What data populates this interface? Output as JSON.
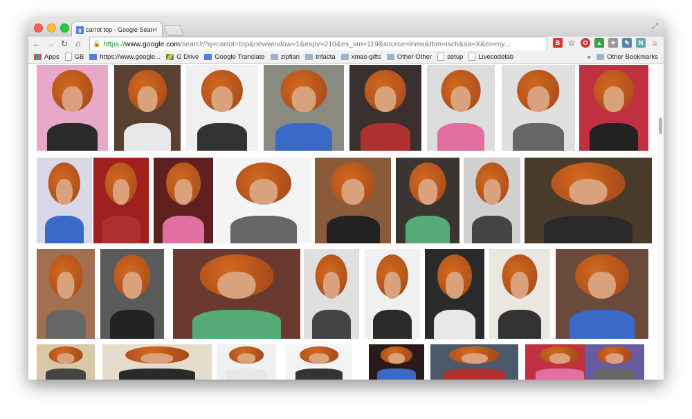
{
  "browser": {
    "tab_title": "carrot top - Google Search",
    "tab_close": "×",
    "url_scheme": "https://",
    "url_host": "www.google.com",
    "url_rest": "/search?q=carrot+top&newwindow=1&espv=210&es_sm=119&source=lnms&tbm=isch&sa=X&ei=my..."
  },
  "bookmarks": [
    {
      "label": "Apps",
      "icon": "apps-grid-icon"
    },
    {
      "label": "GB",
      "icon": "page-icon"
    },
    {
      "label": "https://www.google...",
      "icon": "google-icon"
    },
    {
      "label": "G Drive",
      "icon": "drive-icon"
    },
    {
      "label": "Google Translate",
      "icon": "translate-icon"
    },
    {
      "label": "zipfian",
      "icon": "folder-icon"
    },
    {
      "label": "trifacta",
      "icon": "folder-icon"
    },
    {
      "label": "xmas-gifts",
      "icon": "folder-icon"
    },
    {
      "label": "Other Other",
      "icon": "folder-icon"
    },
    {
      "label": "setup",
      "icon": "page-icon"
    },
    {
      "label": "Livecodelab",
      "icon": "page-icon"
    }
  ],
  "other_bookmarks": "Other Bookmarks",
  "overflow_chevron": "»",
  "colors": {
    "accent": "#4a7ee0",
    "hair": "#c0541e",
    "secure": "#1e8c2f"
  }
}
